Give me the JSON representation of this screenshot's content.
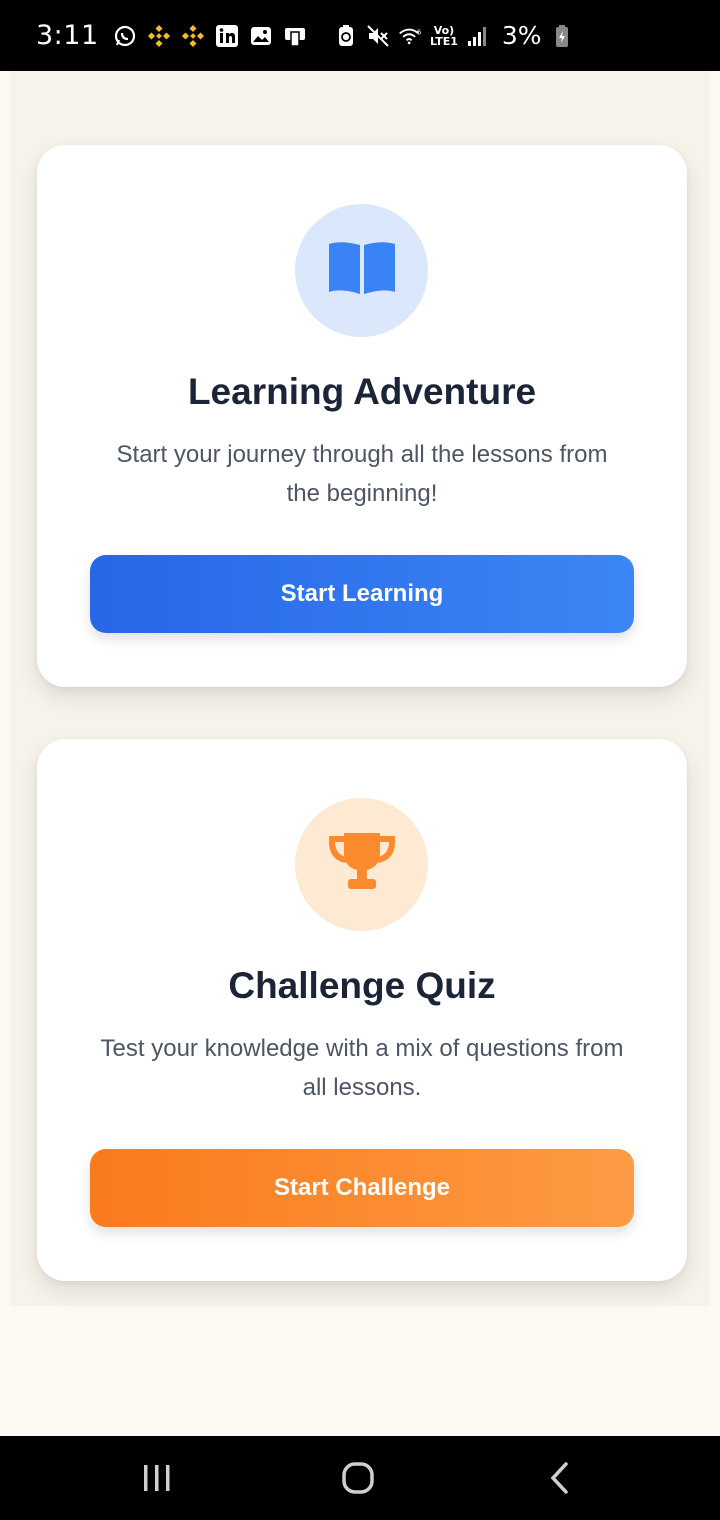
{
  "status_bar": {
    "time": "3:11",
    "battery": "3%",
    "volte_top": "Vo)",
    "volte_bottom": "LTE1",
    "left_icons": [
      "whatsapp-icon",
      "binance-icon",
      "binance-icon",
      "linkedin-icon",
      "gallery-icon",
      "cast-icon"
    ],
    "right_icons": [
      "battery-saver-icon",
      "mute-icon",
      "wifi-icon",
      "signal-icon",
      "battery-icon"
    ]
  },
  "cards": [
    {
      "icon": "book-icon",
      "title": "Learning Adventure",
      "description": "Start your journey through all the lessons from the beginning!",
      "button_label": "Start Learning",
      "accent": "#2f74ee"
    },
    {
      "icon": "trophy-icon",
      "title": "Challenge Quiz",
      "description": "Test your knowledge with a mix of questions from all lessons.",
      "button_label": "Start Challenge",
      "accent": "#f98a2e"
    }
  ],
  "nav_bar": {
    "items": [
      "recents-icon",
      "home-icon",
      "back-icon"
    ]
  },
  "colors": {
    "background": "#fdf9f3",
    "panel": "#f7f2ea",
    "title": "#1c2438",
    "text": "#4e5563"
  }
}
